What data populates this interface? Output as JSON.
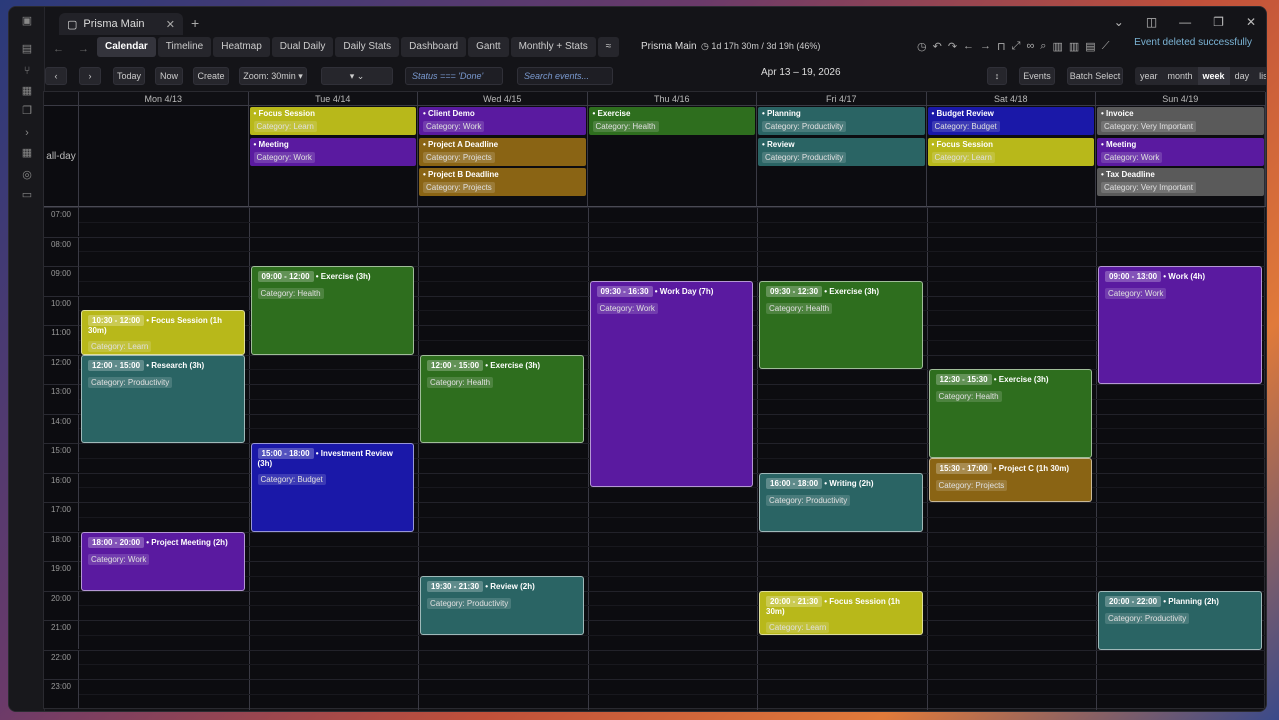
{
  "window": {
    "tab_title": "Prisma Main"
  },
  "toolbar": {
    "views": [
      "Calendar",
      "Timeline",
      "Heatmap",
      "Dual Daily",
      "Daily Stats",
      "Dashboard",
      "Gantt",
      "Monthly + Stats"
    ],
    "calendar_title": "Prisma Main",
    "stat": "1d 17h 30m / 3d 19h (46%)",
    "toast": "Event deleted successfully"
  },
  "controls": {
    "today": "Today",
    "now": "Now",
    "create": "Create",
    "zoom": "Zoom: 30min",
    "filter_placeholder": "Status === 'Done'",
    "search_placeholder": "Search events...",
    "range": "Apr 13 – 19, 2026",
    "sort": "↕",
    "events": "Events",
    "batch": "Batch Select",
    "view_modes": [
      "year",
      "month",
      "week",
      "day",
      "list"
    ]
  },
  "calendar": {
    "allday_label": "all-day",
    "days": [
      "Mon 4/13",
      "Tue 4/14",
      "Wed 4/15",
      "Thu 4/16",
      "Fri 4/17",
      "Sat 4/18",
      "Sun 4/19"
    ],
    "hours": [
      "07:00",
      "08:00",
      "09:00",
      "10:00",
      "11:00",
      "12:00",
      "13:00",
      "14:00",
      "15:00",
      "16:00",
      "17:00",
      "18:00",
      "19:00",
      "20:00",
      "21:00",
      "22:00",
      "23:00"
    ],
    "allday_events": [
      {
        "day": 1,
        "slot": 0,
        "title": "Focus Session",
        "cat": "Category: Learn",
        "color": "#b8b81a"
      },
      {
        "day": 1,
        "slot": 1,
        "title": "Meeting",
        "cat": "Category: Work",
        "color": "#5a1aa0"
      },
      {
        "day": 2,
        "slot": 0,
        "title": "Client Demo",
        "cat": "Category: Work",
        "color": "#5a1aa0"
      },
      {
        "day": 2,
        "slot": 1,
        "title": "Project A Deadline",
        "cat": "Category: Projects",
        "color": "#8a6414"
      },
      {
        "day": 2,
        "slot": 2,
        "title": "Project B Deadline",
        "cat": "Category: Projects",
        "color": "#8a6414"
      },
      {
        "day": 3,
        "slot": 0,
        "title": "Exercise",
        "cat": "Category: Health",
        "color": "#2e6e1e"
      },
      {
        "day": 4,
        "slot": 0,
        "title": "Planning",
        "cat": "Category: Productivity",
        "color": "#2a6464"
      },
      {
        "day": 4,
        "slot": 1,
        "title": "Review",
        "cat": "Category: Productivity",
        "color": "#2a6464"
      },
      {
        "day": 5,
        "slot": 0,
        "title": "Budget Review",
        "cat": "Category: Budget",
        "color": "#1a18a8"
      },
      {
        "day": 5,
        "slot": 1,
        "title": "Focus Session",
        "cat": "Category: Learn",
        "color": "#b8b81a"
      },
      {
        "day": 6,
        "slot": 0,
        "title": "Invoice",
        "cat": "Category: Very Important",
        "color": "#5a5a5a"
      },
      {
        "day": 6,
        "slot": 1,
        "title": "Meeting",
        "cat": "Category: Work",
        "color": "#5a1aa0"
      },
      {
        "day": 6,
        "slot": 2,
        "title": "Tax Deadline",
        "cat": "Category: Very Important",
        "color": "#5a5a5a"
      }
    ],
    "events": [
      {
        "day": 0,
        "start": 10.5,
        "end": 12,
        "time": "10:30 - 12:00",
        "title": "Focus Session (1h 30m)",
        "cat": "Category: Learn",
        "color": "#b8b81a"
      },
      {
        "day": 0,
        "start": 12,
        "end": 15,
        "time": "12:00 - 15:00",
        "title": "Research (3h)",
        "cat": "Category: Productivity",
        "color": "#2a6464"
      },
      {
        "day": 0,
        "start": 18,
        "end": 20,
        "time": "18:00 - 20:00",
        "title": "Project Meeting (2h)",
        "cat": "Category: Work",
        "color": "#5a1aa0"
      },
      {
        "day": 1,
        "start": 9,
        "end": 12,
        "time": "09:00 - 12:00",
        "title": "Exercise (3h)",
        "cat": "Category: Health",
        "color": "#2e6e1e"
      },
      {
        "day": 1,
        "start": 15,
        "end": 18,
        "time": "15:00 - 18:00",
        "title": "Investment Review (3h)",
        "cat": "Category: Budget",
        "color": "#1a18a8"
      },
      {
        "day": 2,
        "start": 12,
        "end": 15,
        "time": "12:00 - 15:00",
        "title": "Exercise (3h)",
        "cat": "Category: Health",
        "color": "#2e6e1e"
      },
      {
        "day": 2,
        "start": 19.5,
        "end": 21.5,
        "time": "19:30 - 21:30",
        "title": "Review (2h)",
        "cat": "Category: Productivity",
        "color": "#2a6464"
      },
      {
        "day": 3,
        "start": 9.5,
        "end": 16.5,
        "time": "09:30 - 16:30",
        "title": "Work Day (7h)",
        "cat": "Category: Work",
        "color": "#5a1aa0"
      },
      {
        "day": 4,
        "start": 9.5,
        "end": 12.5,
        "time": "09:30 - 12:30",
        "title": "Exercise (3h)",
        "cat": "Category: Health",
        "color": "#2e6e1e"
      },
      {
        "day": 4,
        "start": 16,
        "end": 18,
        "time": "16:00 - 18:00",
        "title": "Writing (2h)",
        "cat": "Category: Productivity",
        "color": "#2a6464"
      },
      {
        "day": 4,
        "start": 20,
        "end": 21.5,
        "time": "20:00 - 21:30",
        "title": "Focus Session (1h 30m)",
        "cat": "Category: Learn",
        "color": "#b8b81a"
      },
      {
        "day": 5,
        "start": 12.5,
        "end": 15.5,
        "time": "12:30 - 15:30",
        "title": "Exercise (3h)",
        "cat": "Category: Health",
        "color": "#2e6e1e"
      },
      {
        "day": 5,
        "start": 15.5,
        "end": 17,
        "time": "15:30 - 17:00",
        "title": "Project C (1h 30m)",
        "cat": "Category: Projects",
        "color": "#8a6414"
      },
      {
        "day": 6,
        "start": 9,
        "end": 13,
        "time": "09:00 - 13:00",
        "title": "Work (4h)",
        "cat": "Category: Work",
        "color": "#5a1aa0"
      },
      {
        "day": 6,
        "start": 20,
        "end": 22,
        "time": "20:00 - 22:00",
        "title": "Planning (2h)",
        "cat": "Category: Productivity",
        "color": "#2a6464"
      }
    ]
  }
}
